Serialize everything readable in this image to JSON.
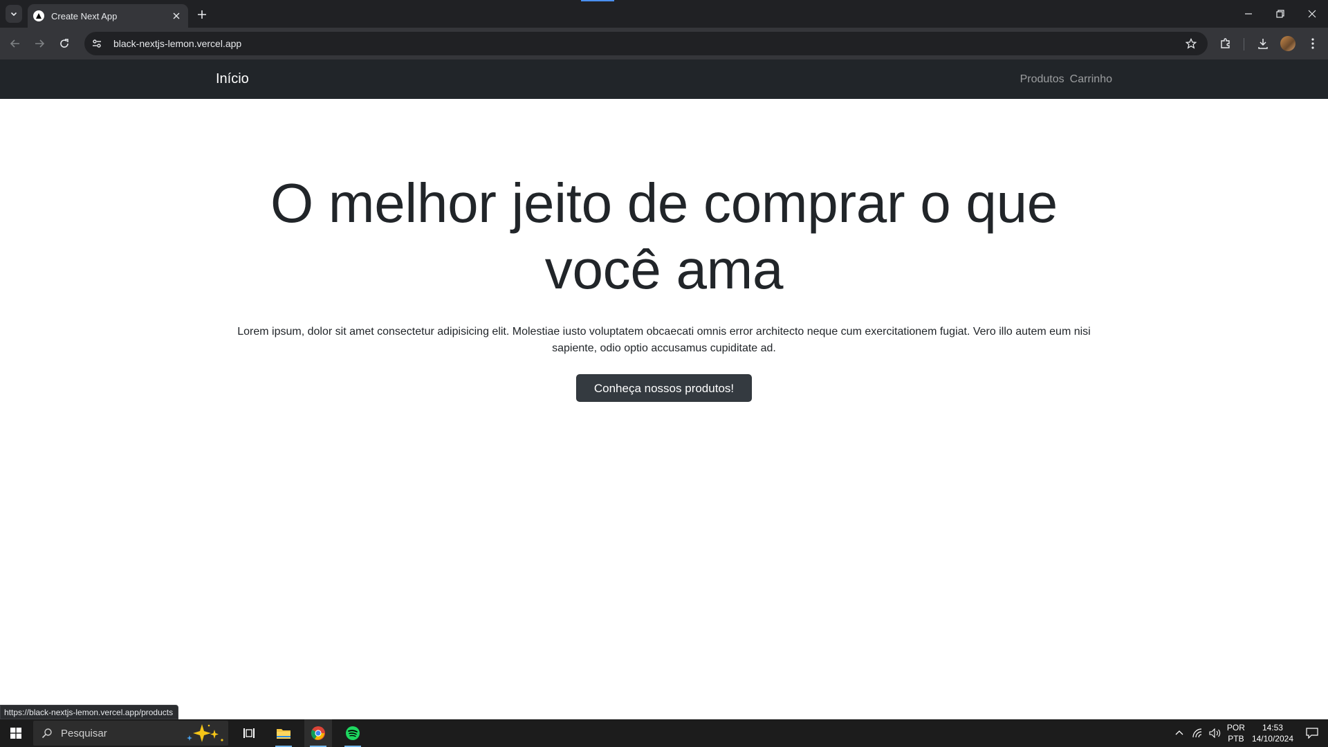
{
  "browser": {
    "tab_title": "Create Next App",
    "url": "black-nextjs-lemon.vercel.app",
    "status_url": "https://black-nextjs-lemon.vercel.app/products"
  },
  "site": {
    "brand": "Início",
    "nav": [
      {
        "label": "Produtos"
      },
      {
        "label": "Carrinho"
      }
    ],
    "hero": {
      "title": "O melhor jeito de comprar o que você ama",
      "text": "Lorem ipsum, dolor sit amet consectetur adipisicing elit. Molestiae iusto voluptatem obcaecati omnis error architecto neque cum exercitationem fugiat. Vero illo autem eum nisi sapiente, odio optio accusamus cupiditate ad.",
      "button": "Conheça nossos produtos!"
    }
  },
  "taskbar": {
    "search_placeholder": "Pesquisar",
    "apps": [
      "file-explorer-icon",
      "chrome-icon",
      "spotify-icon"
    ],
    "lang_line1": "POR",
    "lang_line2": "PTB",
    "time": "14:53",
    "date": "14/10/2024"
  },
  "colors": {
    "navbar": "#212529",
    "button": "#343a40",
    "chrome_dark": "#202124",
    "spotify": "#1ed760"
  }
}
